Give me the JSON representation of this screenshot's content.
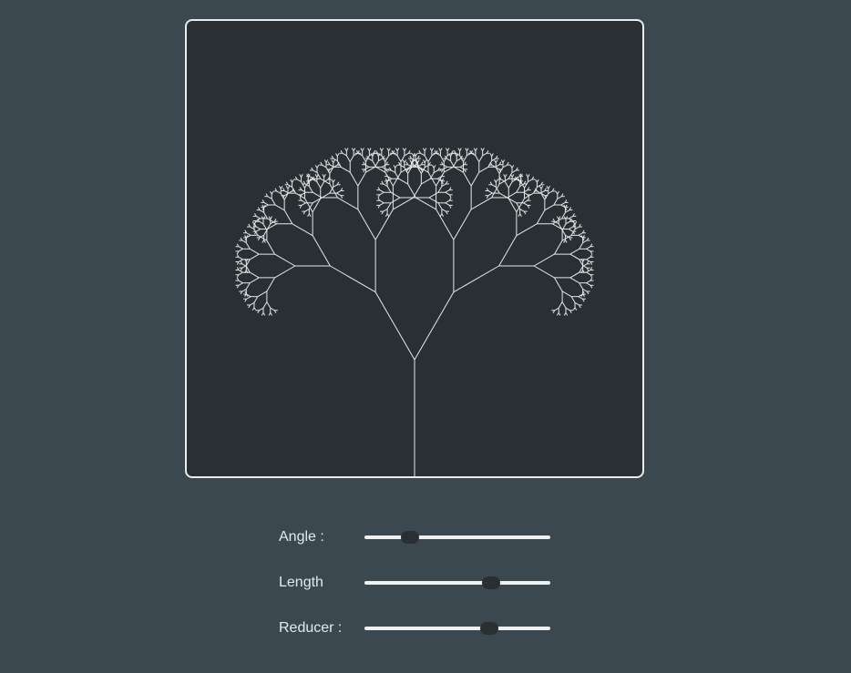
{
  "colors": {
    "page_background": "#3b4850",
    "canvas_background": "#292f33",
    "canvas_border": "#e9eceb",
    "branch_stroke": "#e6e9ea",
    "slider_track": "#eef0f0",
    "slider_thumb": "#292f33",
    "label_text": "#e6e9ea"
  },
  "controls": [
    {
      "label": "Angle :",
      "value_fraction": 0.22
    },
    {
      "label": "Length",
      "value_fraction": 0.7
    },
    {
      "label": "Reducer :",
      "value_fraction": 0.69
    }
  ]
}
